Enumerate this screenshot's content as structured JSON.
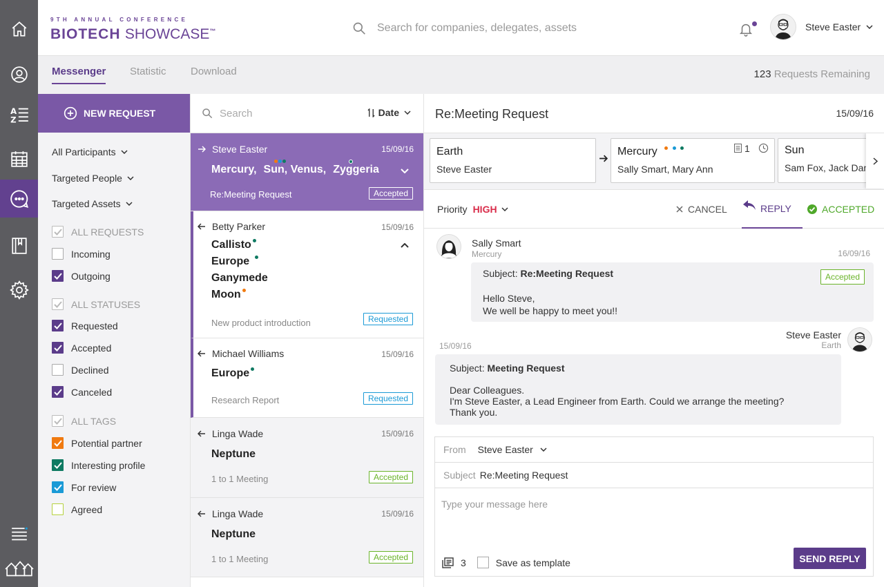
{
  "header": {
    "logo_top": "9TH ANNUAL CONFERENCE",
    "logo_bold": "BIOTECH",
    "logo_light": "SHOWCASE",
    "logo_tm": "™",
    "search_placeholder": "Search for companies, delegates, assets",
    "user_name": "Steve Easter"
  },
  "tabs": {
    "messenger": "Messenger",
    "statistic": "Statistic",
    "download": "Download",
    "remaining_count": "123",
    "remaining_label": "Requests Remaining"
  },
  "filters": {
    "new_request": "NEW REQUEST",
    "all_participants": "All Participants",
    "targeted_people": "Targeted People",
    "targeted_assets": "Targeted Assets",
    "requests_head": "ALL REQUESTS",
    "incoming": "Incoming",
    "outgoing": "Outgoing",
    "statuses_head": "ALL STATUSES",
    "requested": "Requested",
    "accepted": "Accepted",
    "declined": "Declined",
    "canceled": "Canceled",
    "tags_head": "ALL TAGS",
    "potential_partner": "Potential partner",
    "interesting_profile": "Interesting profile",
    "for_review": "For review",
    "agreed": "Agreed"
  },
  "list": {
    "search_placeholder": "Search",
    "sort_label": "Date",
    "items": [
      {
        "who": "Steve Easter",
        "date": "15/09/16",
        "planets": [
          "Mercury,",
          "Sun, Venus,",
          "Zyggeria"
        ],
        "subject": "Re:Meeting Request",
        "status": "Accepted"
      },
      {
        "who": "Betty Parker",
        "date": "15/09/16",
        "planets": [
          "Callisto",
          "Europe",
          "Ganymede",
          "Moon"
        ],
        "subject": "New product introduction",
        "status": "Requested"
      },
      {
        "who": "Michael Williams",
        "date": "15/09/16",
        "planets": [
          "Europe"
        ],
        "subject": "Research Report",
        "status": "Requested"
      },
      {
        "who": "Linga Wade",
        "date": "15/09/16",
        "planets": [
          "Neptune"
        ],
        "subject": "1 to 1 Meeting",
        "status": "Accepted"
      },
      {
        "who": "Linga Wade",
        "date": "15/09/16",
        "planets": [
          "Neptune"
        ],
        "subject": "1 to 1 Meeting",
        "status": "Accepted"
      }
    ]
  },
  "detail": {
    "title": "Re:Meeting Request",
    "date": "15/09/16",
    "route": [
      {
        "name": "Earth",
        "people": "Steve Easter"
      },
      {
        "name": "Mercury",
        "people": "Sally Smart, Mary Ann",
        "doc_count": "1"
      },
      {
        "name": "Sun",
        "people": "Sam Fox, Jack Daniel"
      }
    ],
    "priority_label": "Priority",
    "priority_value": "HIGH",
    "cancel": "CANCEL",
    "reply": "REPLY",
    "accepted": "ACCEPTED",
    "messages": [
      {
        "name": "Sally Smart",
        "org": "Mercury",
        "date": "16/09/16",
        "subject_label": "Subject:",
        "subject": "Re:Meeting Request",
        "status": "Accepted",
        "body": [
          "Hello Steve,",
          "We well be happy to meet you!!"
        ]
      },
      {
        "name": "Steve Easter",
        "org": "Earth",
        "date": "15/09/16",
        "subject_label": "Subject:",
        "subject": "Meeting Request",
        "body": [
          "Dear Colleagues.",
          "I'm Steve Easter, a Lead Engineer from Earth. Could we arrange the meeting?",
          "Thank you."
        ]
      }
    ],
    "compose": {
      "from_label": "From",
      "from_value": "Steve Easter",
      "subject_label": "Subject",
      "subject_value": "Re:Meeting Request",
      "placeholder": "Type your message here",
      "attach_count": "3",
      "save_template": "Save as template",
      "send": "SEND REPLY"
    }
  },
  "colors": {
    "brand": "#6a4496",
    "accent_green": "#6ab42a",
    "requested_blue": "#1a9ad6",
    "priority_red": "#d92c4a"
  }
}
